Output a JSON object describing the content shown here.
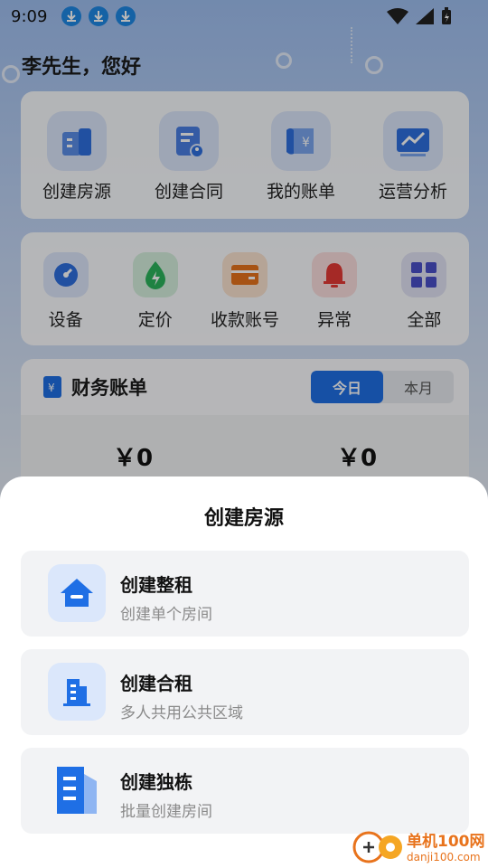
{
  "status": {
    "time": "9:09"
  },
  "greeting": "李先生，您好",
  "quick_actions": [
    {
      "label": "创建房源",
      "icon": "building-icon"
    },
    {
      "label": "创建合同",
      "icon": "contract-icon"
    },
    {
      "label": "我的账单",
      "icon": "bill-icon"
    },
    {
      "label": "运营分析",
      "icon": "chart-icon"
    }
  ],
  "tools": [
    {
      "label": "设备",
      "icon": "gauge-icon"
    },
    {
      "label": "定价",
      "icon": "price-icon"
    },
    {
      "label": "收款账号",
      "icon": "wallet-icon"
    },
    {
      "label": "异常",
      "icon": "bell-icon"
    },
    {
      "label": "全部",
      "icon": "grid-icon"
    }
  ],
  "finance": {
    "title": "财务账单",
    "tab_today": "今日",
    "tab_month": "本月",
    "value_left": "￥0",
    "value_right": "￥0"
  },
  "sheet": {
    "title": "创建房源",
    "options": [
      {
        "title": "创建整租",
        "desc": "创建单个房间"
      },
      {
        "title": "创建合租",
        "desc": "多人共用公共区域"
      },
      {
        "title": "创建独栋",
        "desc": "批量创建房间"
      }
    ]
  },
  "watermark": {
    "cn": "单机100网",
    "en": "danji100.com"
  },
  "colors": {
    "primary": "#1f6fe5",
    "icon_bg": "#dbe6fb"
  }
}
